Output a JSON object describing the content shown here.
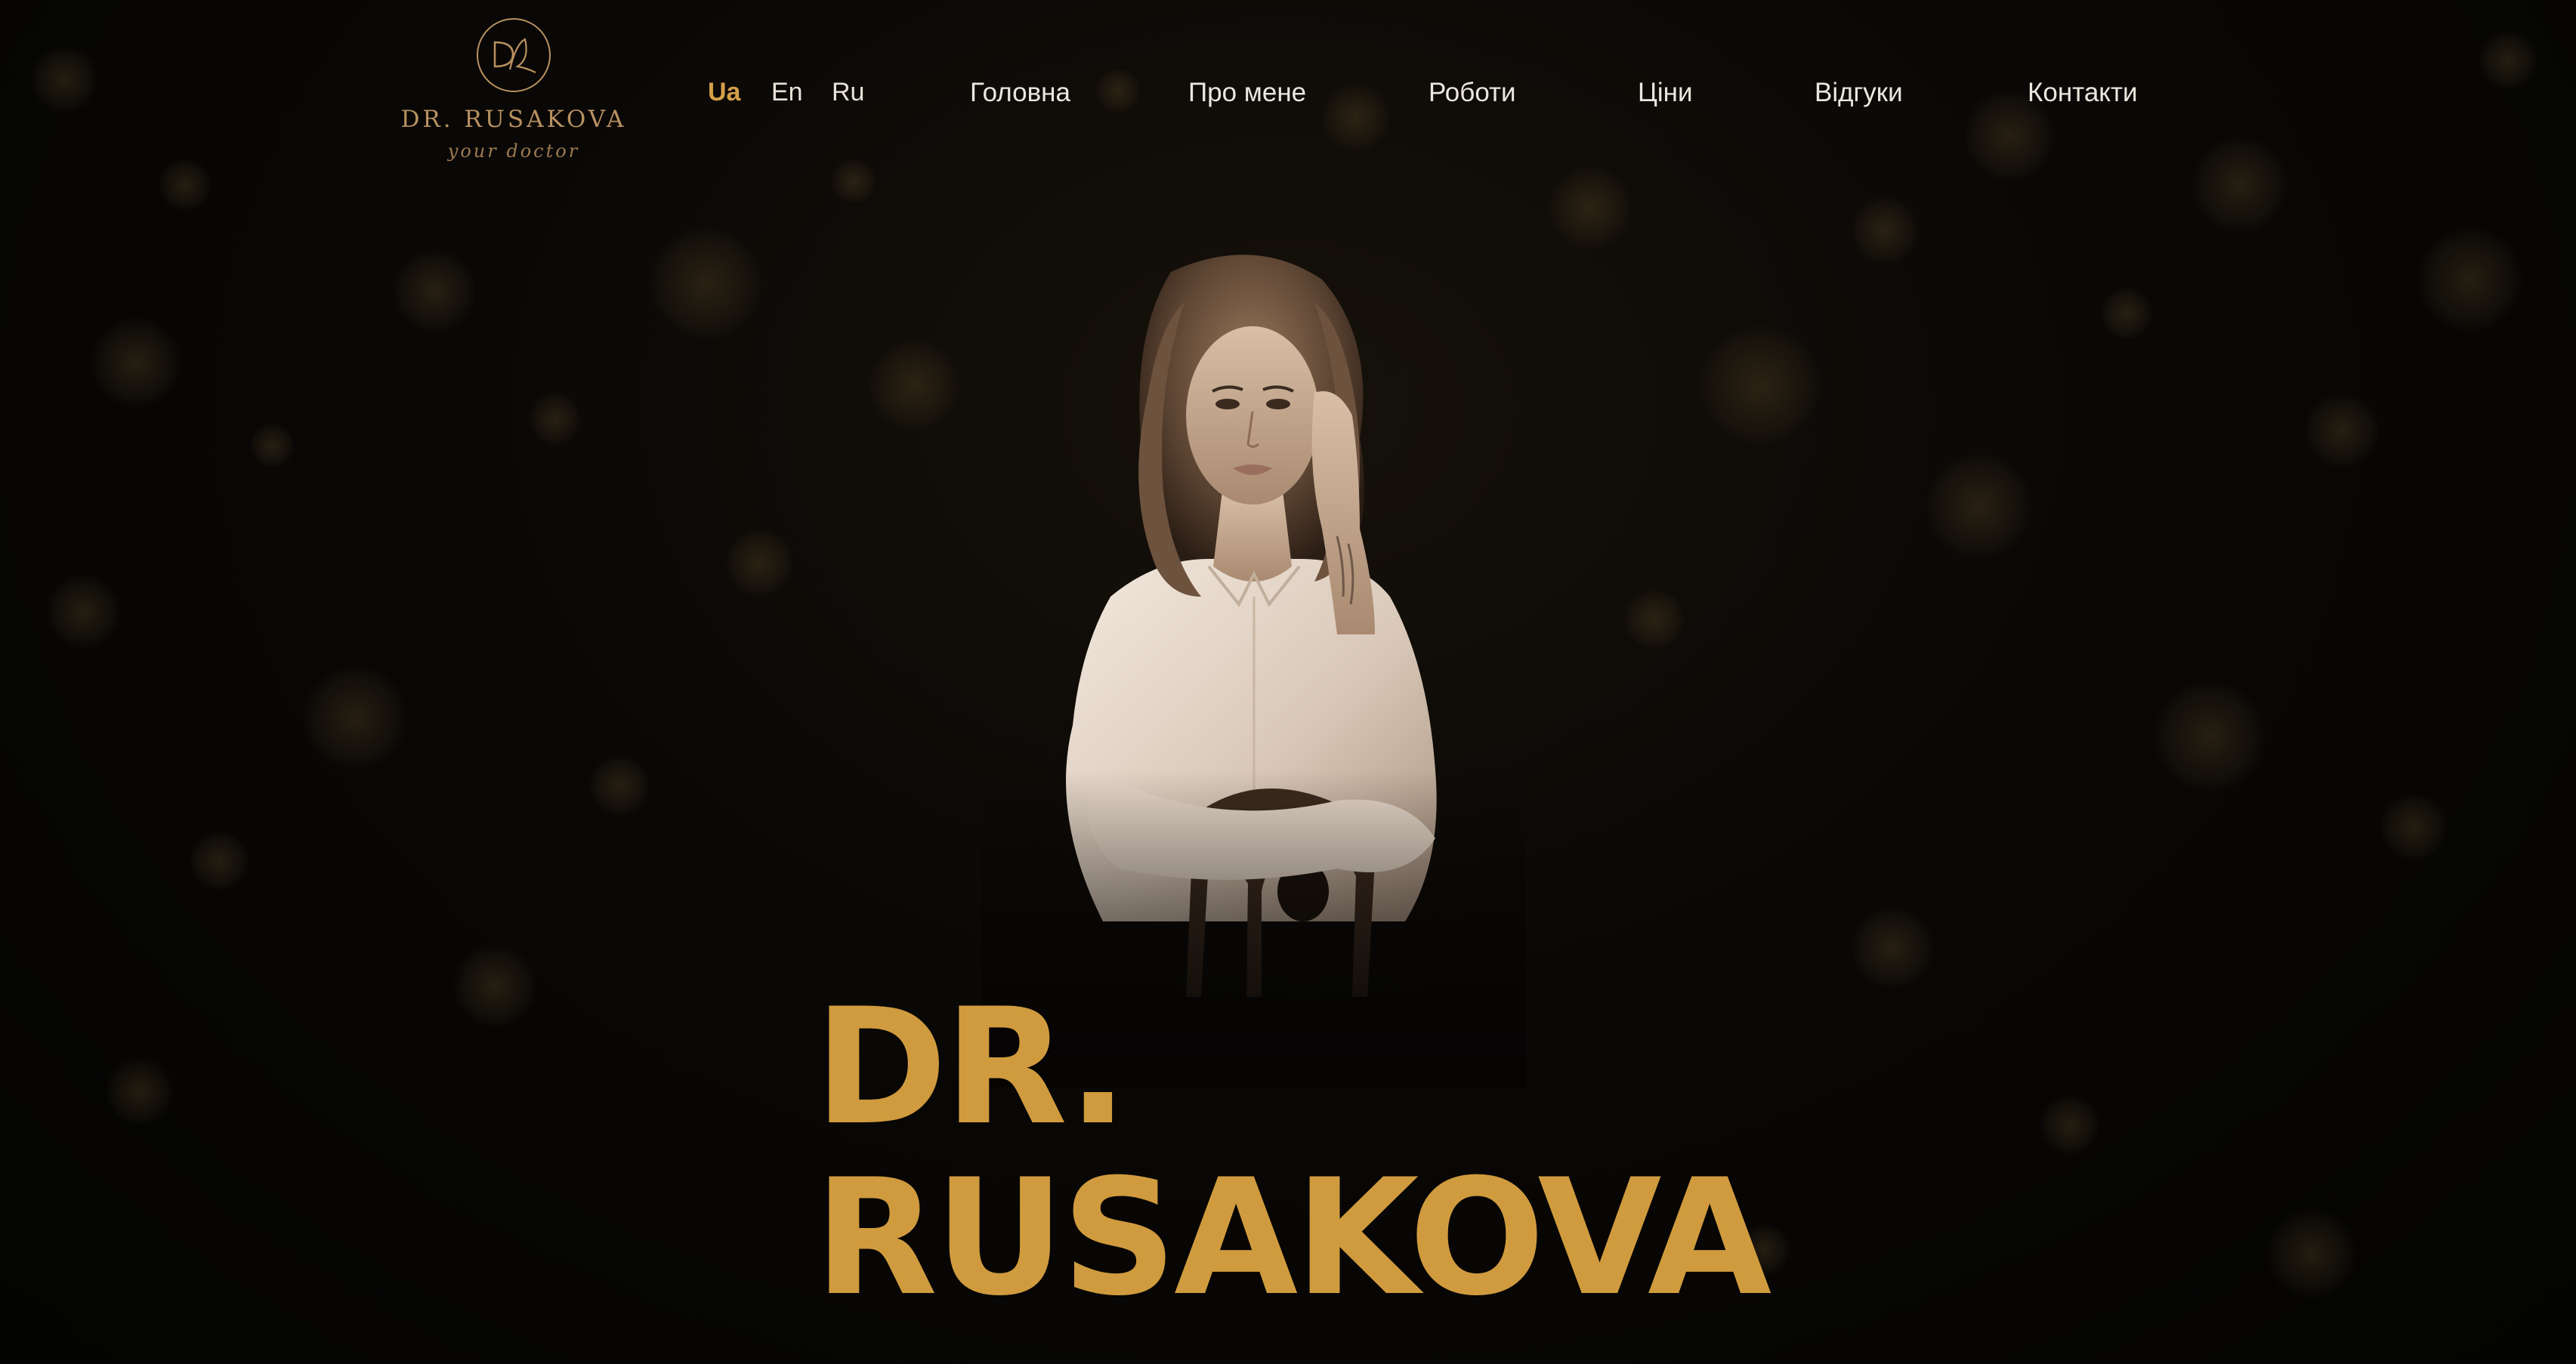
{
  "header": {
    "logo": {
      "monogram": "DR",
      "title": "DR. RUSAKOVA",
      "tagline": "your doctor"
    },
    "languages": [
      {
        "label": "Ua",
        "active": true
      },
      {
        "label": "En",
        "active": false
      },
      {
        "label": "Ru",
        "active": false
      }
    ],
    "nav": [
      {
        "label": "Головна"
      },
      {
        "label": "Про мене"
      },
      {
        "label": "Роботи"
      },
      {
        "label": "Ціни"
      },
      {
        "label": "Відгуки"
      },
      {
        "label": "Контакти"
      }
    ]
  },
  "hero": {
    "title_line1": "DR.",
    "title_line2": "RUSAKOVA",
    "image": "portrait-photo"
  },
  "colors": {
    "accent": "#d09b3e",
    "background": "#050403",
    "nav_text": "#ece7de"
  }
}
